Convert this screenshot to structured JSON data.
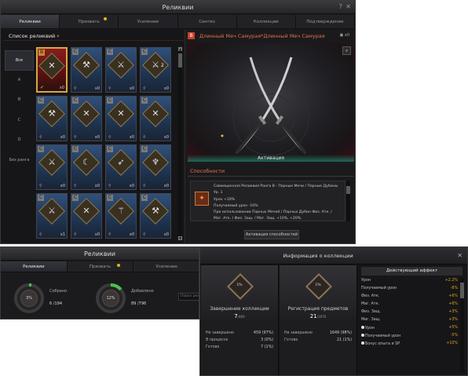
{
  "window": {
    "title": "Реликвии"
  },
  "tabs": [
    {
      "label": "Реликвии",
      "active": true
    },
    {
      "label": "Призвать",
      "dot": true
    },
    {
      "label": "Усиление"
    },
    {
      "label": "Синтез"
    },
    {
      "label": "Коллекции"
    },
    {
      "label": "Подтверждение"
    }
  ],
  "list": {
    "title": "Список реликвий",
    "filters": [
      "Все",
      "A",
      "B",
      "C",
      "D",
      "Без ранга"
    ]
  },
  "cards": [
    {
      "rank": "B",
      "glyph": "✕",
      "count": "x0",
      "sel": true,
      "ok": true
    },
    {
      "rank": "C",
      "glyph": "⚒",
      "count": "x0"
    },
    {
      "rank": "C",
      "glyph": "⚔",
      "count": "x0"
    },
    {
      "rank": "C",
      "glyph": "⚔",
      "count": "x0",
      "extra": "2"
    },
    {
      "rank": "C",
      "glyph": "⚒",
      "count": "x0"
    },
    {
      "rank": "C",
      "glyph": "✕",
      "count": "x0"
    },
    {
      "rank": "C",
      "glyph": "✕",
      "count": "x0"
    },
    {
      "rank": "C",
      "glyph": "✕",
      "count": "x0"
    },
    {
      "rank": "C",
      "glyph": "⚔",
      "count": "x0"
    },
    {
      "rank": "C",
      "glyph": "☾",
      "count": "x0"
    },
    {
      "rank": "C",
      "glyph": "➶",
      "count": "x0"
    },
    {
      "rank": "C",
      "glyph": "♆",
      "count": "x0"
    },
    {
      "rank": "C",
      "glyph": "⚔",
      "count": "x1"
    },
    {
      "rank": "C",
      "glyph": "✕",
      "count": "x0"
    },
    {
      "rank": "C",
      "glyph": "⚚",
      "count": "x0"
    },
    {
      "rank": "C",
      "glyph": "⚒",
      "count": "x0"
    }
  ],
  "relic": {
    "rank": "B",
    "name": "Длинный Меч Самурая*Длинный Меч Самурая",
    "stat": "x0",
    "preview_label": "Активация"
  },
  "abilities": {
    "title": "Способности",
    "lines": [
      "Совмещенная Реликвия Ранга B - Парные Мечи / Парные Дубины",
      "Ур. 1",
      "Урон +10%",
      "Получаемый урон -10%",
      "При использовании Парных Мечей / Парных Дубин Физ. Атк. /",
      "Маг. Атк. / Физ. Защ. / Маг. Защ. +10%, +20%."
    ],
    "button": "Активация способностей"
  },
  "window2": {
    "title": "Реликвии",
    "tabs": [
      "Реликвии",
      "Призвать",
      "Усиление"
    ],
    "collected_label": "Собрано",
    "collected_pct": "3%",
    "collected_val": "6 /194",
    "added_label": "Добавлено",
    "added_pct": "12%",
    "added_val": "89 /796",
    "search_placeholder": "Поиск реликвий"
  },
  "popup": {
    "title": "Информация о коллекции",
    "completion": {
      "pct": "1%",
      "title": "Завершение коллекции",
      "count": "7",
      "total": "/469",
      "rows": [
        {
          "label": "Не завершено",
          "value": "459 (97%)"
        },
        {
          "label": "В процессе",
          "value": "3 (0%)"
        },
        {
          "label": "Готово",
          "value": "7 (1%)"
        }
      ]
    },
    "registration": {
      "pct": "1%",
      "title": "Регистрация предметов",
      "count": "21",
      "total": "/1670",
      "rows": [
        {
          "label": "Не завершено",
          "value": "1649 (98%)"
        },
        {
          "label": "Готово",
          "value": "21 (1%)"
        }
      ]
    },
    "effects": {
      "title": "Действующий аффект",
      "rows": [
        {
          "label": "Урон",
          "value": "+2.2%"
        },
        {
          "label": "Получаемый урон",
          "value": "-8%"
        },
        {
          "label": "Физ. Атк.",
          "value": "+6%"
        },
        {
          "label": "Маг. Атк.",
          "value": "+6%"
        },
        {
          "label": "Физ. Защ.",
          "value": "+3%"
        },
        {
          "label": "Маг. Защ.",
          "value": "+3%"
        },
        {
          "label": "Урон",
          "value": "+5%",
          "ex": true
        },
        {
          "label": "Получаемый урон",
          "value": "-5%",
          "ex": true
        },
        {
          "label": "Бонус опыта и SP",
          "value": "+10%",
          "ex": true
        }
      ]
    }
  },
  "colors": {
    "accent": "#e56e4a",
    "rank_b": "#c7402f",
    "gold": "#d9a646",
    "effect_value": "#e0a020"
  }
}
